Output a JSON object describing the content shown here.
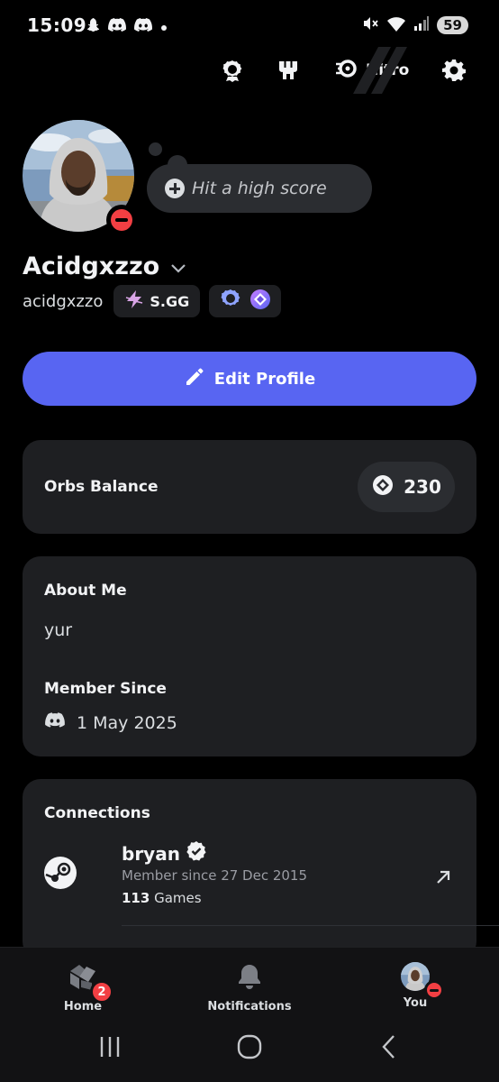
{
  "status_bar": {
    "time": "15:09",
    "battery": "59",
    "left_icons": [
      "snapchat-icon",
      "discord-icon",
      "discord-icon",
      "dot-icon"
    ],
    "right_icons": [
      "mute-icon",
      "wifi-icon",
      "signal-icon"
    ]
  },
  "top_bar": {
    "nitro_label": "Nitro",
    "icons": [
      "quests-icon",
      "shop-icon",
      "nitro-icon",
      "settings-icon"
    ]
  },
  "profile": {
    "display_name": "Acidgxzzo",
    "username": "acidgxzzo",
    "status_placeholder": "Hit a high score",
    "server_tag": "S.GG",
    "status": "dnd"
  },
  "edit_profile_label": "Edit Profile",
  "orbs": {
    "label": "Orbs Balance",
    "value": "230"
  },
  "about": {
    "title": "About Me",
    "text": "yur",
    "member_since_title": "Member Since",
    "member_since_date": "1 May 2025"
  },
  "connections": {
    "title": "Connections",
    "items": [
      {
        "service": "steam",
        "name": "bryan",
        "since": "Member since 27 Dec 2015",
        "games_count": "113",
        "games_label": "Games"
      }
    ]
  },
  "bottom_nav": {
    "items": [
      {
        "label": "Home",
        "badge": "2"
      },
      {
        "label": "Notifications"
      },
      {
        "label": "You"
      }
    ]
  },
  "colors": {
    "accent": "#5865f2",
    "dnd": "#f23f43",
    "card": "#1e1f22",
    "background": "#000000"
  }
}
